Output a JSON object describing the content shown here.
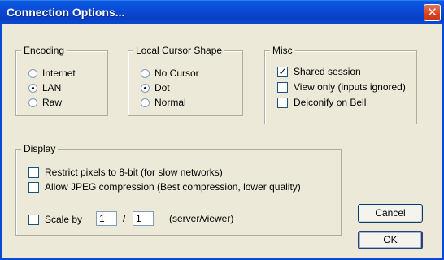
{
  "window": {
    "title": "Connection Options...",
    "close_symbol": "✕"
  },
  "encoding": {
    "legend": "Encoding",
    "options": [
      "Internet",
      "LAN",
      "Raw"
    ],
    "selected": "LAN"
  },
  "cursor": {
    "legend": "Local Cursor Shape",
    "options": [
      "No Cursor",
      "Dot",
      "Normal"
    ],
    "selected": "Dot"
  },
  "misc": {
    "legend": "Misc",
    "shared_session": {
      "label": "Shared session",
      "checked": true,
      "mark": "✓"
    },
    "view_only": {
      "label": "View only (inputs ignored)",
      "checked": false
    },
    "deiconify": {
      "label": "Deiconify on Bell",
      "checked": false
    }
  },
  "display": {
    "legend": "Display",
    "restrict_8bit": {
      "label": "Restrict pixels to 8-bit (for slow networks)",
      "checked": false
    },
    "jpeg": {
      "label": "Allow JPEG compression (Best compression, lower quality)",
      "checked": false
    },
    "scale": {
      "label": "Scale by",
      "checked": false,
      "numerator": "1",
      "separator": "/",
      "denominator": "1",
      "suffix": "(server/viewer)"
    }
  },
  "buttons": {
    "cancel": "Cancel",
    "ok": "OK"
  },
  "colors": {
    "titlebar": "#0a4ad6",
    "dialog_bg": "#ece9d8",
    "close_button": "#d8431e"
  }
}
